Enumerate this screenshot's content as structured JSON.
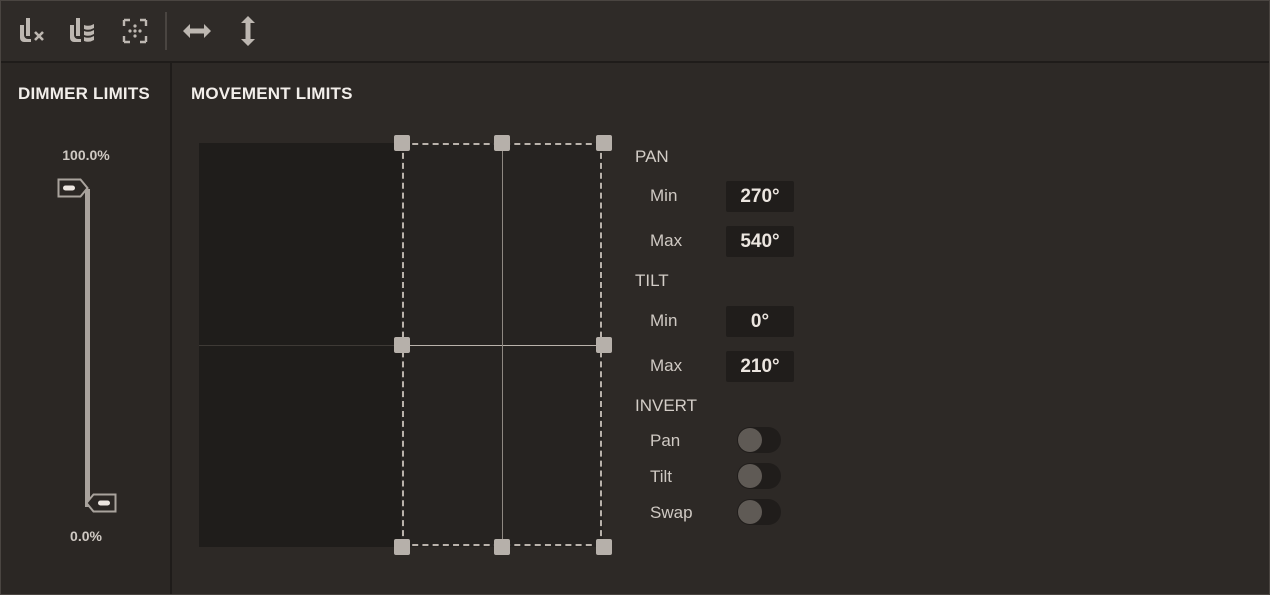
{
  "toolbar": {
    "icons": [
      "dimmer-off-icon",
      "dimmer-curve-icon",
      "focus-center-icon",
      "horizontal-arrows-icon",
      "vertical-arrows-icon"
    ]
  },
  "dimmer": {
    "title": "DIMMER LIMITS",
    "max_label": "100.0%",
    "min_label": "0.0%",
    "max_value": 100.0,
    "min_value": 0.0
  },
  "movement": {
    "title": "MOVEMENT LIMITS",
    "pan": {
      "label": "PAN",
      "min_label": "Min",
      "min_value": "270°",
      "max_label": "Max",
      "max_value": "540°"
    },
    "tilt": {
      "label": "TILT",
      "min_label": "Min",
      "min_value": "0°",
      "max_label": "Max",
      "max_value": "210°"
    },
    "invert": {
      "label": "INVERT",
      "pan_label": "Pan",
      "pan_on": false,
      "tilt_label": "Tilt",
      "tilt_on": false,
      "swap_label": "Swap",
      "swap_on": false
    }
  },
  "colors": {
    "background": "#2d2926",
    "accent": "#b6b0aa",
    "text": "#d8d2cc"
  }
}
